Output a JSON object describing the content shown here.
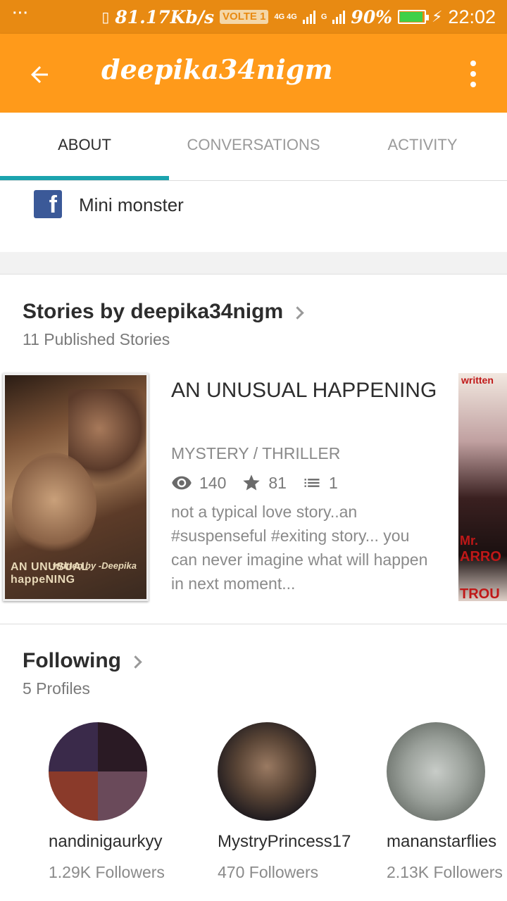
{
  "status_bar": {
    "dots": "···",
    "speed": "81.17Kb/s",
    "volte": "VOLTE 1",
    "net1": "4G 4G",
    "net2": "G",
    "battery_pct": "90%",
    "battery_level": 0.9,
    "time": "22:02"
  },
  "app_bar": {
    "title": "deepika34nigm",
    "back_icon": "arrow-left-icon",
    "menu_icon": "more-vertical-icon"
  },
  "tabs": [
    {
      "label": "ABOUT",
      "active": true
    },
    {
      "label": "CONVERSATIONS",
      "active": false
    },
    {
      "label": "ACTIVITY",
      "active": false
    }
  ],
  "about": {
    "facebook_icon": "facebook-icon",
    "facebook_label": "Mini monster"
  },
  "stories": {
    "title": "Stories by deepika34nigm",
    "subtitle": "11 Published Stories",
    "items": [
      {
        "title": "AN UNUSUAL HAPPENING",
        "genre": "MYSTERY / THRILLER",
        "views": "140",
        "votes": "81",
        "parts": "1",
        "description": "not a typical love story..an #suspenseful #exiting story... you can never imagine what will happen in next moment...",
        "cover_text_author": "written by -Deepika",
        "cover_text_title": "AN UNUSUAL happeNING"
      }
    ],
    "next_cover_text": [
      "written",
      "Mr.",
      "ARRO",
      "TROU"
    ]
  },
  "following": {
    "title": "Following",
    "subtitle": "5 Profiles",
    "profiles": [
      {
        "name": "nandinigaurkyy",
        "followers": "1.29K Followers"
      },
      {
        "name": "MystryPrincess17",
        "followers": "470 Followers"
      },
      {
        "name": "mananstarflies",
        "followers": "2.13K Followers"
      }
    ]
  },
  "colors": {
    "status_bar": "#e88a12",
    "app_bar": "#ff9a1a",
    "tab_indicator": "#1ba3ae",
    "facebook": "#3b5998"
  }
}
